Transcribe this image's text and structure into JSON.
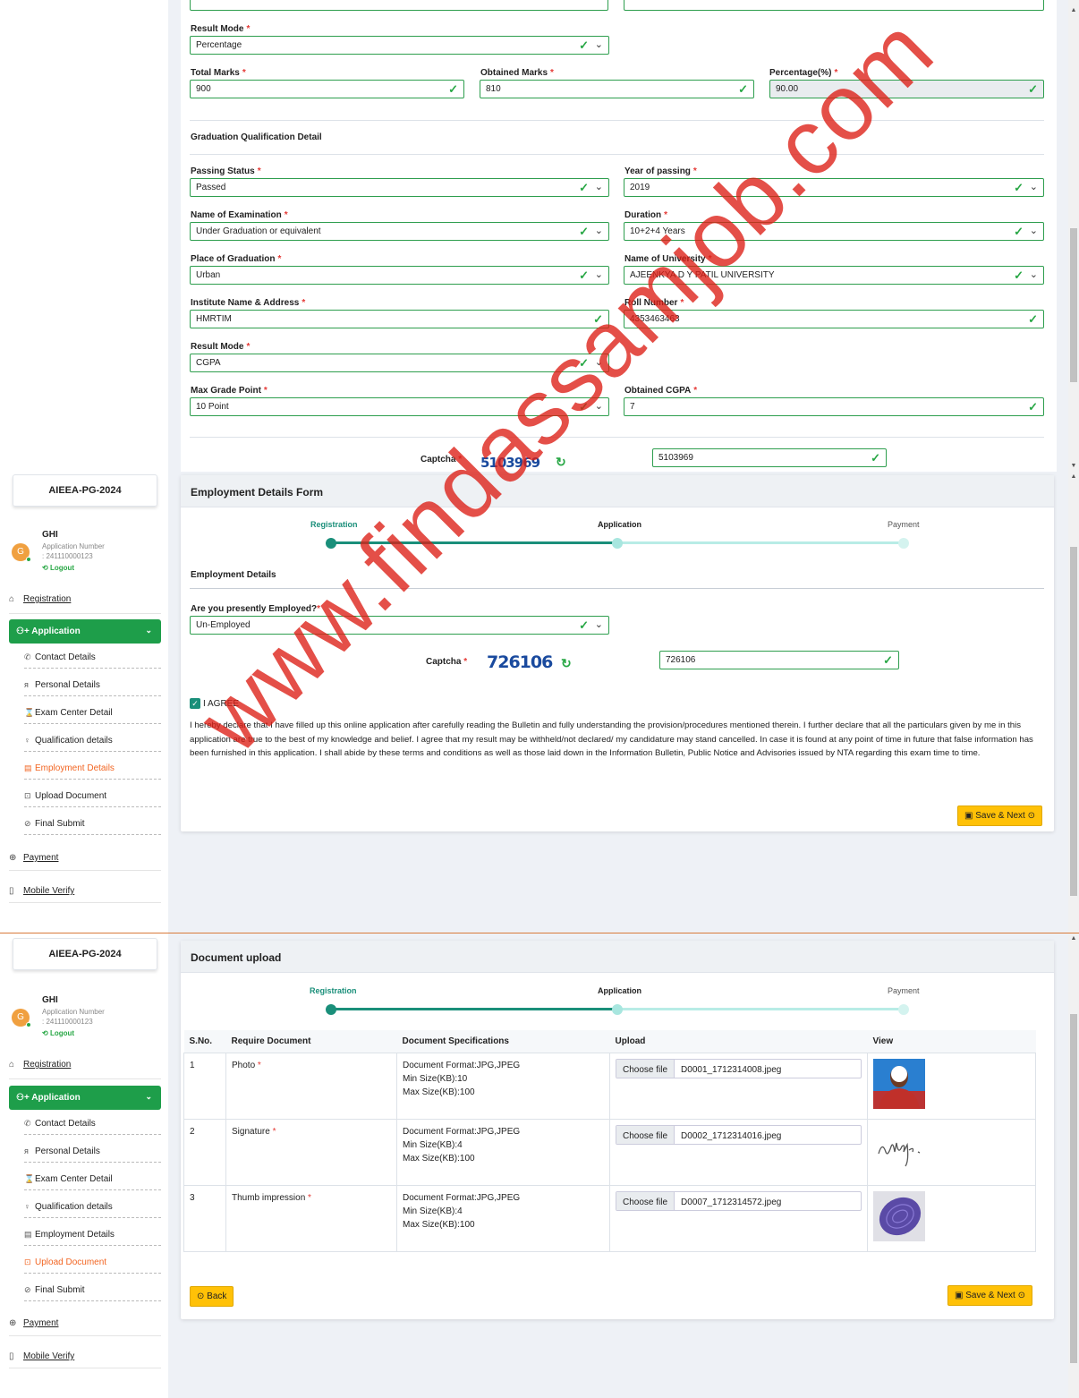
{
  "section1": {
    "result_mode": {
      "label": "Result Mode",
      "value": "Percentage"
    },
    "total_marks": {
      "label": "Total Marks",
      "value": "900"
    },
    "obtained_marks": {
      "label": "Obtained Marks",
      "value": "810"
    },
    "percentage": {
      "label": "Percentage(%)",
      "value": "90.00"
    },
    "grad_title": "Graduation Qualification Detail",
    "passing_status": {
      "label": "Passing Status",
      "value": "Passed"
    },
    "year_of_passing": {
      "label": "Year of passing",
      "value": "2019"
    },
    "name_of_exam": {
      "label": "Name of Examination",
      "value": "Under Graduation or equivalent"
    },
    "duration": {
      "label": "Duration",
      "value": "10+2+4 Years"
    },
    "place_of_grad": {
      "label": "Place of Graduation",
      "value": "Urban"
    },
    "university": {
      "label": "Name of University",
      "value": "AJEENKYA D Y PATIL UNIVERSITY"
    },
    "institute": {
      "label": "Institute Name & Address",
      "value": "HMRTIM"
    },
    "roll_number": {
      "label": "Roll Number",
      "value": "4353463463"
    },
    "result_mode2": {
      "label": "Result Mode",
      "value": "CGPA"
    },
    "max_grade": {
      "label": "Max Grade Point",
      "value": "10 Point"
    },
    "obtained_cgpa": {
      "label": "Obtained CGPA",
      "value": "7"
    },
    "captcha_label": "Captcha",
    "captcha_image": "5103969",
    "captcha_value": "5103969"
  },
  "sidebar": {
    "brand": "AIEEA-PG-2024",
    "user_name": "GHI",
    "user_initial": "G",
    "app_number_label": "Application Number",
    "app_number": ": 241110000123",
    "logout": "Logout",
    "registration": "Registration",
    "application": "Application",
    "sub_items": [
      "Contact Details",
      "Personal Details",
      "Exam Center Detail",
      "Qualification details",
      "Employment Details",
      "Upload Document",
      "Final Submit"
    ],
    "payment": "Payment",
    "mobile_verify": "Mobile Verify"
  },
  "section2": {
    "title": "Employment Details Form",
    "steps": [
      "Registration",
      "Application",
      "Payment"
    ],
    "subtitle": "Employment Details",
    "employed": {
      "label": "Are you presently Employed?",
      "value": "Un-Employed"
    },
    "captcha_label": "Captcha",
    "captcha_image": "726106",
    "captcha_value": "726106",
    "agree_label": "I AGREE",
    "declaration": "I hereby declare that I have filled up this online application after carefully reading the Bulletin and fully understanding the provision/procedures mentioned therein. I further declare that all the particulars given by me in this application are true to the best of my knowledge and belief. I agree that my result may be withheld/not declared/ my candidature may stand cancelled. In case it is found at any point of time in future that false information has been furnished in this application. I shall abide by these terms and conditions as well as those laid down in the Information Bulletin, Public Notice and Advisories issued by NTA regarding this exam time to time.",
    "save_next": "Save & Next"
  },
  "section3": {
    "title": "Document upload",
    "steps": [
      "Registration",
      "Application",
      "Payment"
    ],
    "columns": [
      "S.No.",
      "Require Document",
      "Document Specifications",
      "Upload",
      "View"
    ],
    "rows": [
      {
        "sno": "1",
        "doc": "Photo",
        "spec": [
          "Document Format:JPG,JPEG",
          "Min Size(KB):10",
          "Max Size(KB):100"
        ],
        "file": "D0001_1712314008.jpeg"
      },
      {
        "sno": "2",
        "doc": "Signature",
        "spec": [
          "Document Format:JPG,JPEG",
          "Min Size(KB):4",
          "Max Size(KB):100"
        ],
        "file": "D0002_1712314016.jpeg"
      },
      {
        "sno": "3",
        "doc": "Thumb impression",
        "spec": [
          "Document Format:JPG,JPEG",
          "Min Size(KB):4",
          "Max Size(KB):100"
        ],
        "file": "D0007_1712314572.jpeg"
      }
    ],
    "choose_file": "Choose file",
    "back": "Back",
    "save_next": "Save & Next"
  },
  "watermark": "www.findassamjob.com",
  "colors": {
    "green": "#1e9e4a",
    "orange": "#f26522",
    "yellow": "#ffc107",
    "teal": "#1a8f7a"
  }
}
